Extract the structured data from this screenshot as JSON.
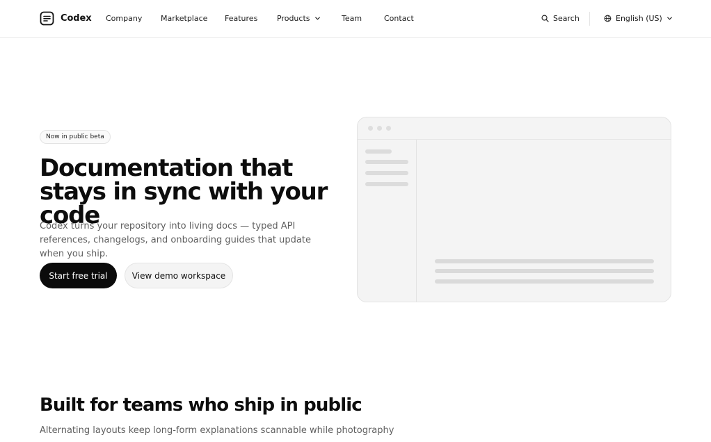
{
  "header": {
    "brand": "Codex",
    "nav": [
      {
        "label": "Company"
      },
      {
        "label": "Marketplace"
      },
      {
        "label": "Features"
      },
      {
        "label": "Products"
      },
      {
        "label": "Team"
      },
      {
        "label": "Contact"
      }
    ],
    "search_label": "Search",
    "language_label": "English (US)"
  },
  "hero": {
    "badge": "Now in public beta",
    "title": "Documentation that stays in sync with your code",
    "subtitle": "Codex turns your repository into living docs — typed API references, changelogs, and onboarding guides that update when you ship.",
    "primary_cta": "Start free trial",
    "secondary_cta": "View demo workspace"
  },
  "section": {
    "title": "Built for teams who ship in public",
    "subtitle": "Alternating layouts keep long-form explanations scannable while photography"
  },
  "colors": {
    "primary_button": "#0b0b0b",
    "mock_background": "#f4f4f4"
  },
  "icons": [
    "document-logo-icon",
    "chevron-down-icon",
    "search-icon",
    "globe-icon"
  ]
}
